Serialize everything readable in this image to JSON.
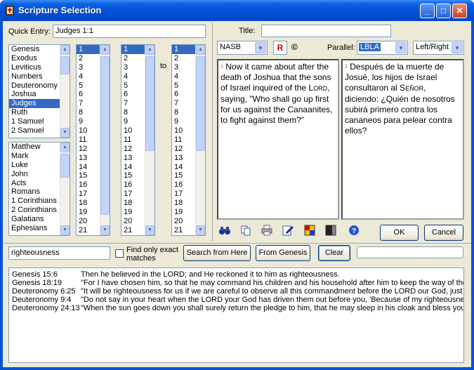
{
  "window": {
    "title": "Scripture Selection",
    "minimize": "_",
    "maximize": "□",
    "close": "✕"
  },
  "quick_entry": {
    "label": "Quick Entry:",
    "value": "Judges 1:1"
  },
  "ot_books": [
    "Genesis",
    "Exodus",
    "Leviticus",
    "Numbers",
    "Deuteronomy",
    "Joshua",
    "Judges",
    "Ruth",
    "1 Samuel",
    "2 Samuel"
  ],
  "ot_selected_index": 6,
  "nt_books": [
    "Matthew",
    "Mark",
    "Luke",
    "John",
    "Acts",
    "Romans",
    "1 Corinthians",
    "2 Corinthians",
    "Galatians",
    "Ephesians"
  ],
  "chapters": [
    "1",
    "2",
    "3",
    "4",
    "5",
    "6",
    "7",
    "8",
    "9",
    "10",
    "11",
    "12",
    "13",
    "14",
    "15",
    "16",
    "17",
    "18",
    "19",
    "20",
    "21"
  ],
  "verses_from": [
    "1",
    "2",
    "3",
    "4",
    "5",
    "6",
    "7",
    "8",
    "9",
    "10",
    "11",
    "12",
    "13",
    "14",
    "15",
    "16",
    "17",
    "18",
    "19",
    "20",
    "21"
  ],
  "verses_to": [
    "1",
    "2",
    "3",
    "4",
    "5",
    "6",
    "7",
    "8",
    "9",
    "10",
    "11",
    "12",
    "13",
    "14",
    "15",
    "16",
    "17",
    "18",
    "19",
    "20",
    "21"
  ],
  "to_label": "to",
  "title_field": {
    "label": "Title:",
    "value": ""
  },
  "version": {
    "selected": "NASB",
    "red_letter": "R",
    "copyright": "©"
  },
  "parallel": {
    "label": "Parallel:",
    "selected": "LBLA",
    "layout": "Left/Right"
  },
  "primary_text": {
    "verse_num": "1",
    "before_lord": "Now it came about after the death of Joshua that the sons of Israel inquired of the ",
    "lord_L": "L",
    "lord_rest": "ORD",
    "after_lord": ", saying, \"Who shall go up first for us against the Canaanites, to fight against them?\""
  },
  "parallel_text": {
    "verse_num": "1",
    "before_lord": "Después de la muerte de Josué, los hijos de Israel consultaron al ",
    "lord_S": "S",
    "lord_rest": "EÑOR",
    "after_lord": ", diciendo: ¿Quién de nosotros subirá primero contra los cananeos para pelear contra ellos?"
  },
  "toolbar_icons": [
    "binoculars-icon",
    "copy-icon",
    "print-icon",
    "edit-icon",
    "color-icon",
    "background-icon",
    "help-icon"
  ],
  "buttons": {
    "ok": "OK",
    "cancel": "Cancel"
  },
  "search": {
    "value": "righteousness",
    "exact_label_line1": "Find only exact",
    "exact_label_line2": "matches",
    "exact_checked": false,
    "search_here": "Search from Here",
    "from_genesis": "From Genesis",
    "clear": "Clear",
    "progress": 0
  },
  "results": [
    {
      "ref": "Genesis 15:6",
      "text": "Then he believed in the LORD; and He reckoned it to him as righteousness."
    },
    {
      "ref": "Genesis 18:19",
      "text": "\"For I have chosen him, so that he may command his children and his household after him to keep the way of the LORD by doing righteousness"
    },
    {
      "ref": "Deuteronomy 6:25",
      "text": "\"It will be righteousness for us if we are careful to observe all this commandment before the LORD our God, just as He commanded us."
    },
    {
      "ref": "Deuteronomy 9:4",
      "text": "\"Do not say in your heart when the LORD your God has driven them out before you, 'Because of my righteousness the LORD has brought me in"
    },
    {
      "ref": "Deuteronomy 24:13",
      "text": "\"When the sun goes down you shall surely return the pledge to him, that he may sleep in his cloak and bless you; and it will be righteousness"
    }
  ]
}
